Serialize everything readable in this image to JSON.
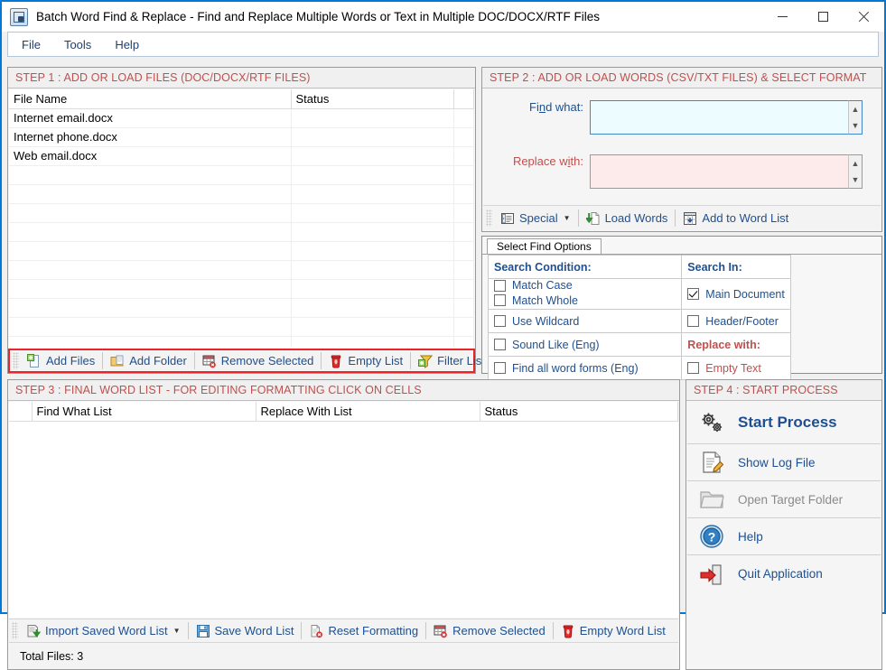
{
  "window": {
    "title": "Batch Word Find & Replace - Find and Replace Multiple Words or Text  in Multiple DOC/DOCX/RTF Files",
    "app_icon": "app-logo-icon",
    "controls": {
      "minimize": "minimize-icon",
      "maximize": "maximize-icon",
      "close": "close-icon"
    }
  },
  "menubar": {
    "items": [
      {
        "label": "File"
      },
      {
        "label": "Tools"
      },
      {
        "label": "Help"
      }
    ]
  },
  "step1": {
    "title": "STEP 1 : ADD OR LOAD FILES (DOC/DOCX/RTF FILES)",
    "columns": [
      "File Name",
      "Status",
      ""
    ],
    "rows": [
      {
        "file_name": "Internet email.docx",
        "status": ""
      },
      {
        "file_name": "Internet phone.docx",
        "status": ""
      },
      {
        "file_name": "Web email.docx",
        "status": ""
      }
    ],
    "empty_row_count": 12,
    "toolbar": [
      {
        "label": "Add Files",
        "icon": "add-files-icon",
        "caret": false
      },
      {
        "label": "Add Folder",
        "icon": "add-folder-icon",
        "caret": false
      },
      {
        "label": "Remove Selected",
        "icon": "remove-selected-icon",
        "caret": false
      },
      {
        "label": "Empty List",
        "icon": "empty-list-icon",
        "caret": false
      },
      {
        "label": "Filter List",
        "icon": "filter-list-icon",
        "caret": true
      }
    ],
    "toolbar_highlight_color": "#e8262a"
  },
  "step2": {
    "title": "STEP 2 : ADD OR LOAD WORDS (CSV/TXT FILES) & SELECT FORMAT",
    "find_label_pre": "Fi",
    "find_label_accel": "n",
    "find_label_post": "d what:",
    "find_value": "",
    "replace_label_pre": "Replace w",
    "replace_label_accel": "i",
    "replace_label_post": "th:",
    "replace_value": "",
    "toolbar": [
      {
        "label": "Special",
        "icon": "special-icon",
        "caret": true
      },
      {
        "label": "Load Words",
        "icon": "load-words-icon",
        "caret": false
      },
      {
        "label": "Add to Word List",
        "icon": "add-to-word-list-icon",
        "caret": false
      }
    ]
  },
  "find_options": {
    "tab_label": "Select Find Options",
    "search_condition_header": "Search Condition:",
    "search_in_header": "Search In:",
    "replace_with_header": "Replace with:",
    "conditions": [
      {
        "label": "Match Case",
        "checked": false
      },
      {
        "label": "Match Whole",
        "checked": false
      },
      {
        "label": "Use Wildcard",
        "checked": false
      },
      {
        "label": "Sound Like (Eng)",
        "checked": false
      },
      {
        "label": "Find all word forms (Eng)",
        "checked": false
      }
    ],
    "search_in": [
      {
        "label": "Main Document",
        "checked": true
      },
      {
        "label": "Header/Footer",
        "checked": false
      }
    ],
    "replace_with": [
      {
        "label": "Empty Text",
        "checked": false
      }
    ]
  },
  "step3": {
    "title": "STEP 3 : FINAL WORD LIST - FOR EDITING FORMATTING CLICK ON CELLS",
    "columns": [
      "",
      "Find What List",
      "Replace With List",
      "Status"
    ],
    "rows": [],
    "toolbar": [
      {
        "label": "Import Saved Word List",
        "icon": "import-word-list-icon",
        "caret": true
      },
      {
        "label": "Save Word List",
        "icon": "save-word-list-icon",
        "caret": false
      },
      {
        "label": "Reset Formatting",
        "icon": "reset-formatting-icon",
        "caret": false
      },
      {
        "label": "Remove Selected",
        "icon": "remove-selected-icon",
        "caret": false
      },
      {
        "label": "Empty Word List",
        "icon": "empty-word-list-icon",
        "caret": false
      }
    ],
    "status_text": "Total Files: 3"
  },
  "step4": {
    "title": "STEP 4 : START PROCESS",
    "items": [
      {
        "label": "Start Process",
        "icon": "gears-icon",
        "style": "strong"
      },
      {
        "label": "Show Log File",
        "icon": "log-file-icon",
        "style": "normal"
      },
      {
        "label": "Open Target Folder",
        "icon": "open-folder-icon",
        "style": "disabled"
      },
      {
        "label": "Help",
        "icon": "help-icon",
        "style": "normal"
      },
      {
        "label": "Quit Application",
        "icon": "quit-icon",
        "style": "normal"
      }
    ]
  },
  "colors": {
    "accent_border": "#0078d7",
    "step_title": "#c0504d",
    "link_blue": "#1d4f91",
    "highlight_red": "#e8262a",
    "find_field_bg": "#edfcff",
    "replace_field_bg": "#fdeaea"
  }
}
